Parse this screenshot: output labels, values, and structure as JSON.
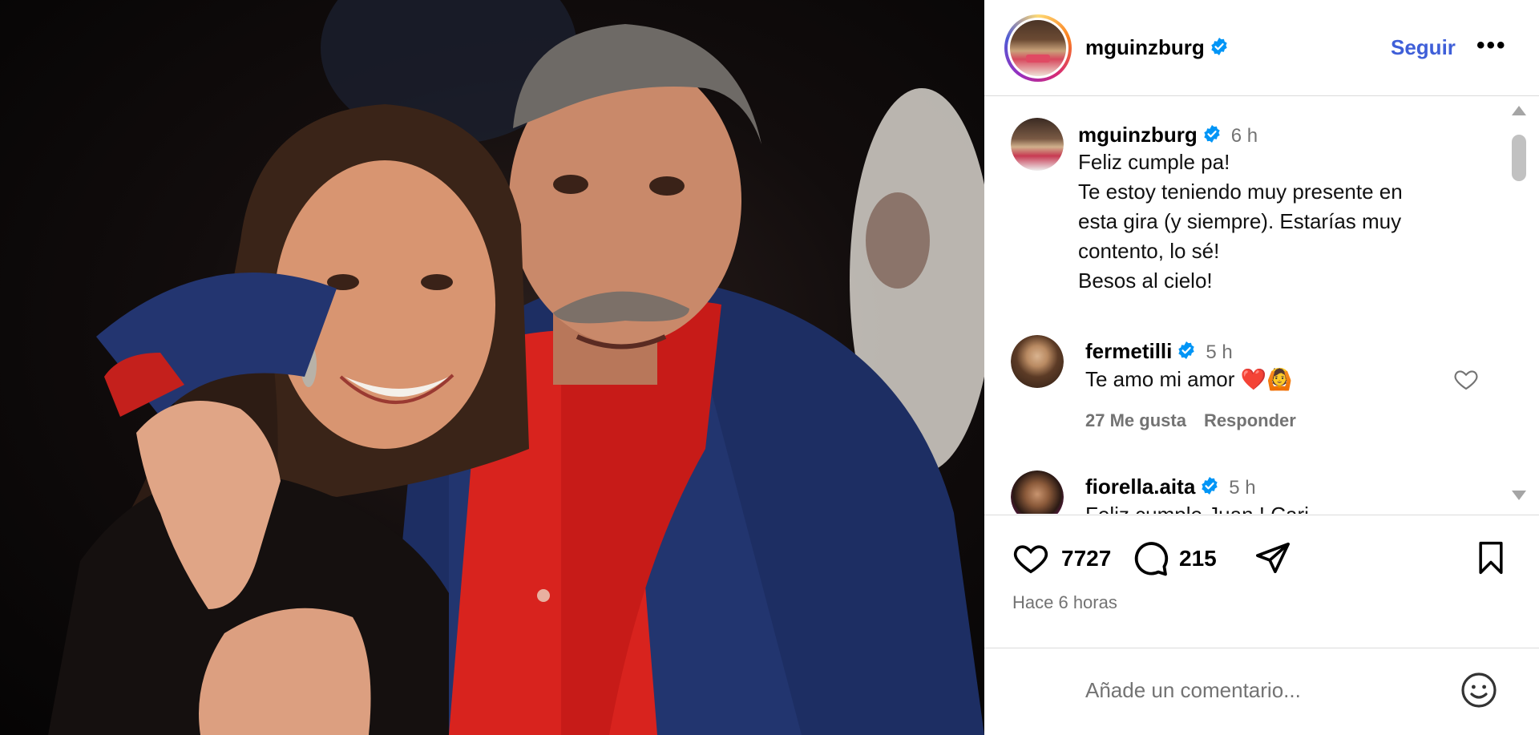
{
  "post": {
    "author": "mguinzburg",
    "follow_label": "Seguir",
    "more_label": "•••",
    "caption": {
      "time": "6 h",
      "text": "Feliz cumple pa!\nTe estoy teniendo muy presente en\nesta gira (y siempre). Estarías muy\ncontento, lo sé!\nBesos al cielo!"
    }
  },
  "comments": [
    {
      "user": "fermetilli",
      "time": "5 h",
      "text": "Te amo mi amor ❤️🙆",
      "likes": "27 Me gusta",
      "reply": "Responder"
    },
    {
      "user": "fiorella.aita",
      "time": "5 h",
      "text": "Feliz cumple Juan ! Cari..."
    }
  ],
  "actions": {
    "likes": "7727",
    "comments": "215",
    "time_ago": "Hace 6 horas"
  },
  "add_comment": {
    "placeholder": "Añade un comentario..."
  },
  "colors": {
    "accent": "#3f5fd8",
    "verified": "#0095f6",
    "muted": "#737373"
  },
  "icons": [
    "verified-badge-icon",
    "more-icon",
    "heart-icon",
    "comment-icon",
    "share-icon",
    "bookmark-icon",
    "emoji-icon",
    "scroll-up-icon",
    "scroll-down-icon"
  ]
}
